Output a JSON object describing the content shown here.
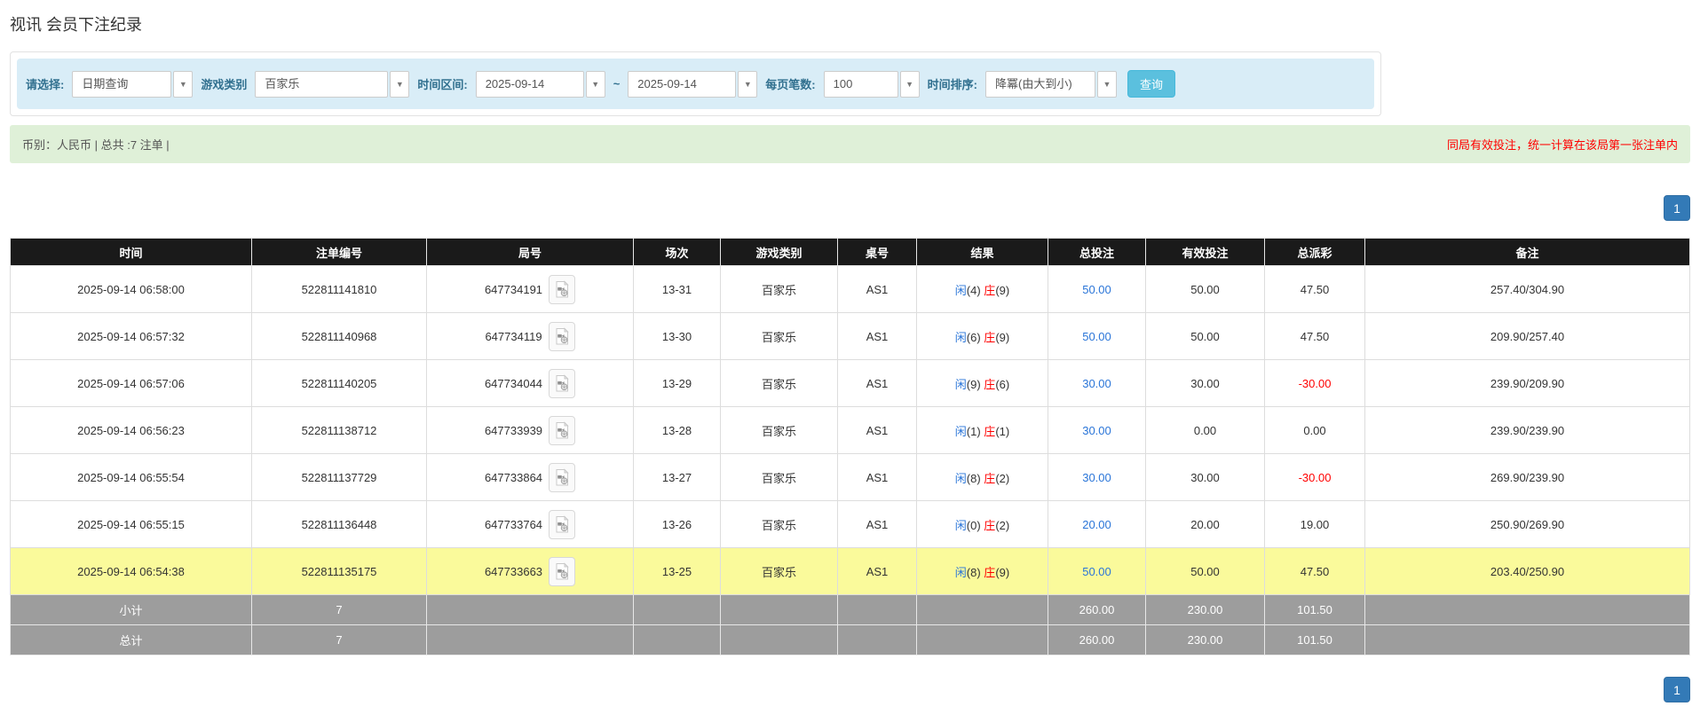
{
  "page": {
    "title": "视讯 会员下注纪录"
  },
  "filters": {
    "select_label": "请选择:",
    "query_type": "日期查询",
    "game_type_label": "游戏类别",
    "game_type": "百家乐",
    "date_range_label": "时间区间:",
    "date_from": "2025-09-14",
    "range_separator": "~",
    "date_to": "2025-09-14",
    "page_size_label": "每页笔数:",
    "page_size": "100",
    "sort_label": "时间排序:",
    "sort_order": "降冪(由大到小)",
    "query_button": "查询"
  },
  "info": {
    "summary": "币别：人民币 | 总共 :7 注单 |",
    "notice": "同局有效投注，统一计算在该局第一张注单内"
  },
  "pagination": {
    "page": "1"
  },
  "table": {
    "columns": [
      "时间",
      "注单编号",
      "局号",
      "场次",
      "游戏类别",
      "桌号",
      "结果",
      "总投注",
      "有效投注",
      "总派彩",
      "备注"
    ],
    "result_labels": {
      "player": "闲",
      "banker": "庄"
    },
    "rows": [
      {
        "time": "2025-09-14 06:58:00",
        "bet_id": "522811141810",
        "round_id": "647734191",
        "session": "13-31",
        "game": "百家乐",
        "table_no": "AS1",
        "player": 4,
        "banker": 9,
        "total_bet": "50.00",
        "valid_bet": "50.00",
        "payout": "47.50",
        "remark": "257.40/304.90",
        "highlight": false
      },
      {
        "time": "2025-09-14 06:57:32",
        "bet_id": "522811140968",
        "round_id": "647734119",
        "session": "13-30",
        "game": "百家乐",
        "table_no": "AS1",
        "player": 6,
        "banker": 9,
        "total_bet": "50.00",
        "valid_bet": "50.00",
        "payout": "47.50",
        "remark": "209.90/257.40",
        "highlight": false
      },
      {
        "time": "2025-09-14 06:57:06",
        "bet_id": "522811140205",
        "round_id": "647734044",
        "session": "13-29",
        "game": "百家乐",
        "table_no": "AS1",
        "player": 9,
        "banker": 6,
        "total_bet": "30.00",
        "valid_bet": "30.00",
        "payout": "-30.00",
        "remark": "239.90/209.90",
        "highlight": false
      },
      {
        "time": "2025-09-14 06:56:23",
        "bet_id": "522811138712",
        "round_id": "647733939",
        "session": "13-28",
        "game": "百家乐",
        "table_no": "AS1",
        "player": 1,
        "banker": 1,
        "total_bet": "30.00",
        "valid_bet": "0.00",
        "payout": "0.00",
        "remark": "239.90/239.90",
        "highlight": false
      },
      {
        "time": "2025-09-14 06:55:54",
        "bet_id": "522811137729",
        "round_id": "647733864",
        "session": "13-27",
        "game": "百家乐",
        "table_no": "AS1",
        "player": 8,
        "banker": 2,
        "total_bet": "30.00",
        "valid_bet": "30.00",
        "payout": "-30.00",
        "remark": "269.90/239.90",
        "highlight": false
      },
      {
        "time": "2025-09-14 06:55:15",
        "bet_id": "522811136448",
        "round_id": "647733764",
        "session": "13-26",
        "game": "百家乐",
        "table_no": "AS1",
        "player": 0,
        "banker": 2,
        "total_bet": "20.00",
        "valid_bet": "20.00",
        "payout": "19.00",
        "remark": "250.90/269.90",
        "highlight": false
      },
      {
        "time": "2025-09-14 06:54:38",
        "bet_id": "522811135175",
        "round_id": "647733663",
        "session": "13-25",
        "game": "百家乐",
        "table_no": "AS1",
        "player": 8,
        "banker": 9,
        "total_bet": "50.00",
        "valid_bet": "50.00",
        "payout": "47.50",
        "remark": "203.40/250.90",
        "highlight": true
      }
    ],
    "summary_rows": [
      {
        "label": "小计",
        "count": "7",
        "total_bet": "260.00",
        "valid_bet": "230.00",
        "payout": "101.50"
      },
      {
        "label": "总计",
        "count": "7",
        "total_bet": "260.00",
        "valid_bet": "230.00",
        "payout": "101.50"
      }
    ]
  },
  "colors": {
    "accent_blue": "#337ab7",
    "link_blue": "#2a75d8",
    "player_blue": "#2a75d8",
    "banker_red": "#ff0000",
    "negative_red": "#ff0000",
    "highlight_yellow": "#fafa9b",
    "header_black": "#1a1a1a",
    "summary_gray": "#9d9d9d",
    "filter_bg": "#d9edf7",
    "info_bg": "#dff0d8",
    "query_button_bg": "#5bc0de"
  },
  "icons": {
    "dropdown": "chevron-down-icon",
    "video": "video-icon"
  }
}
